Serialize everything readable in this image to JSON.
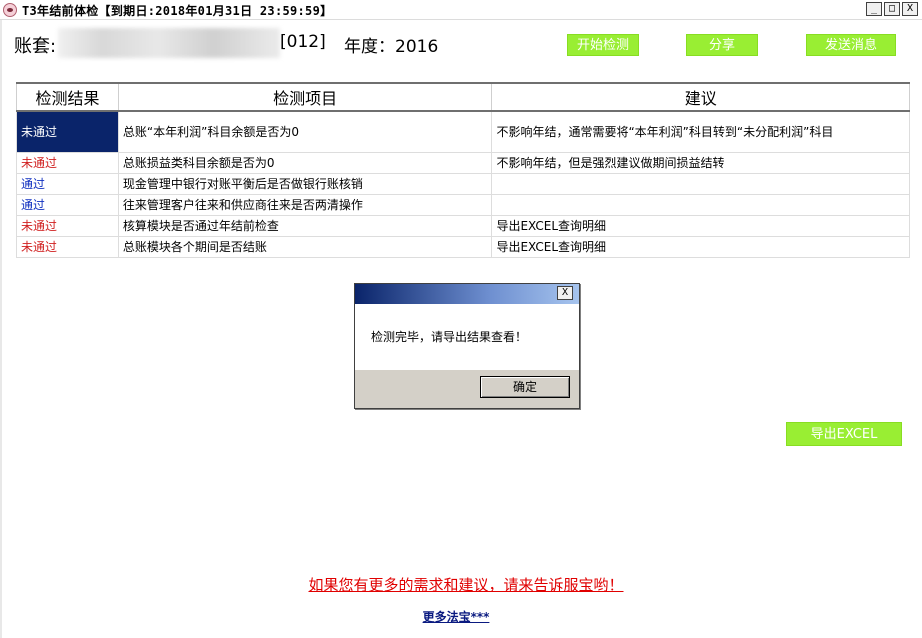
{
  "window": {
    "title": "T3年结前体检【到期日:2018年01月31日 23:59:59】",
    "controls": {
      "minimize": "_",
      "maximize": "□",
      "close": "X"
    },
    "icon": "pig-icon"
  },
  "header": {
    "account_label": "账套:",
    "account_code": "[012]",
    "year_label": "年度：2016",
    "buttons": {
      "start": "开始检测",
      "share": "分享",
      "send": "发送消息"
    }
  },
  "table": {
    "headers": [
      "检测结果",
      "检测项目",
      "建议"
    ],
    "rows": [
      {
        "result": "未通过",
        "status": "fail",
        "item": "总账“本年利润”科目余额是否为0",
        "advice": "不影响年结，通常需要将“本年利润”科目转到“未分配利润”科目"
      },
      {
        "result": "未通过",
        "status": "fail",
        "item": "总账损益类科目余额是否为0",
        "advice": "不影响年结，但是强烈建议做期间损益结转"
      },
      {
        "result": "通过",
        "status": "pass",
        "item": "现金管理中银行对账平衡后是否做银行账核销",
        "advice": ""
      },
      {
        "result": "通过",
        "status": "pass",
        "item": "往来管理客户往来和供应商往来是否两清操作",
        "advice": ""
      },
      {
        "result": "未通过",
        "status": "fail",
        "item": "核算模块是否通过年结前检查",
        "advice": "导出EXCEL查询明细"
      },
      {
        "result": "未通过",
        "status": "fail",
        "item": "总账模块各个期间是否结账",
        "advice": "导出EXCEL查询明细"
      }
    ]
  },
  "dialog": {
    "message": "检测完毕，请导出结果查看！",
    "ok_label": "确定",
    "close_glyph": "X"
  },
  "export_button": "导出EXCEL",
  "footer": {
    "feedback": "如果您有更多的需求和建议，请来告诉服宝哟！",
    "more": "更多法宝***"
  },
  "colors": {
    "button_green": "#99ee33",
    "fail_red": "#d02020",
    "pass_blue": "#1030c0",
    "selection": "#0a246a"
  }
}
